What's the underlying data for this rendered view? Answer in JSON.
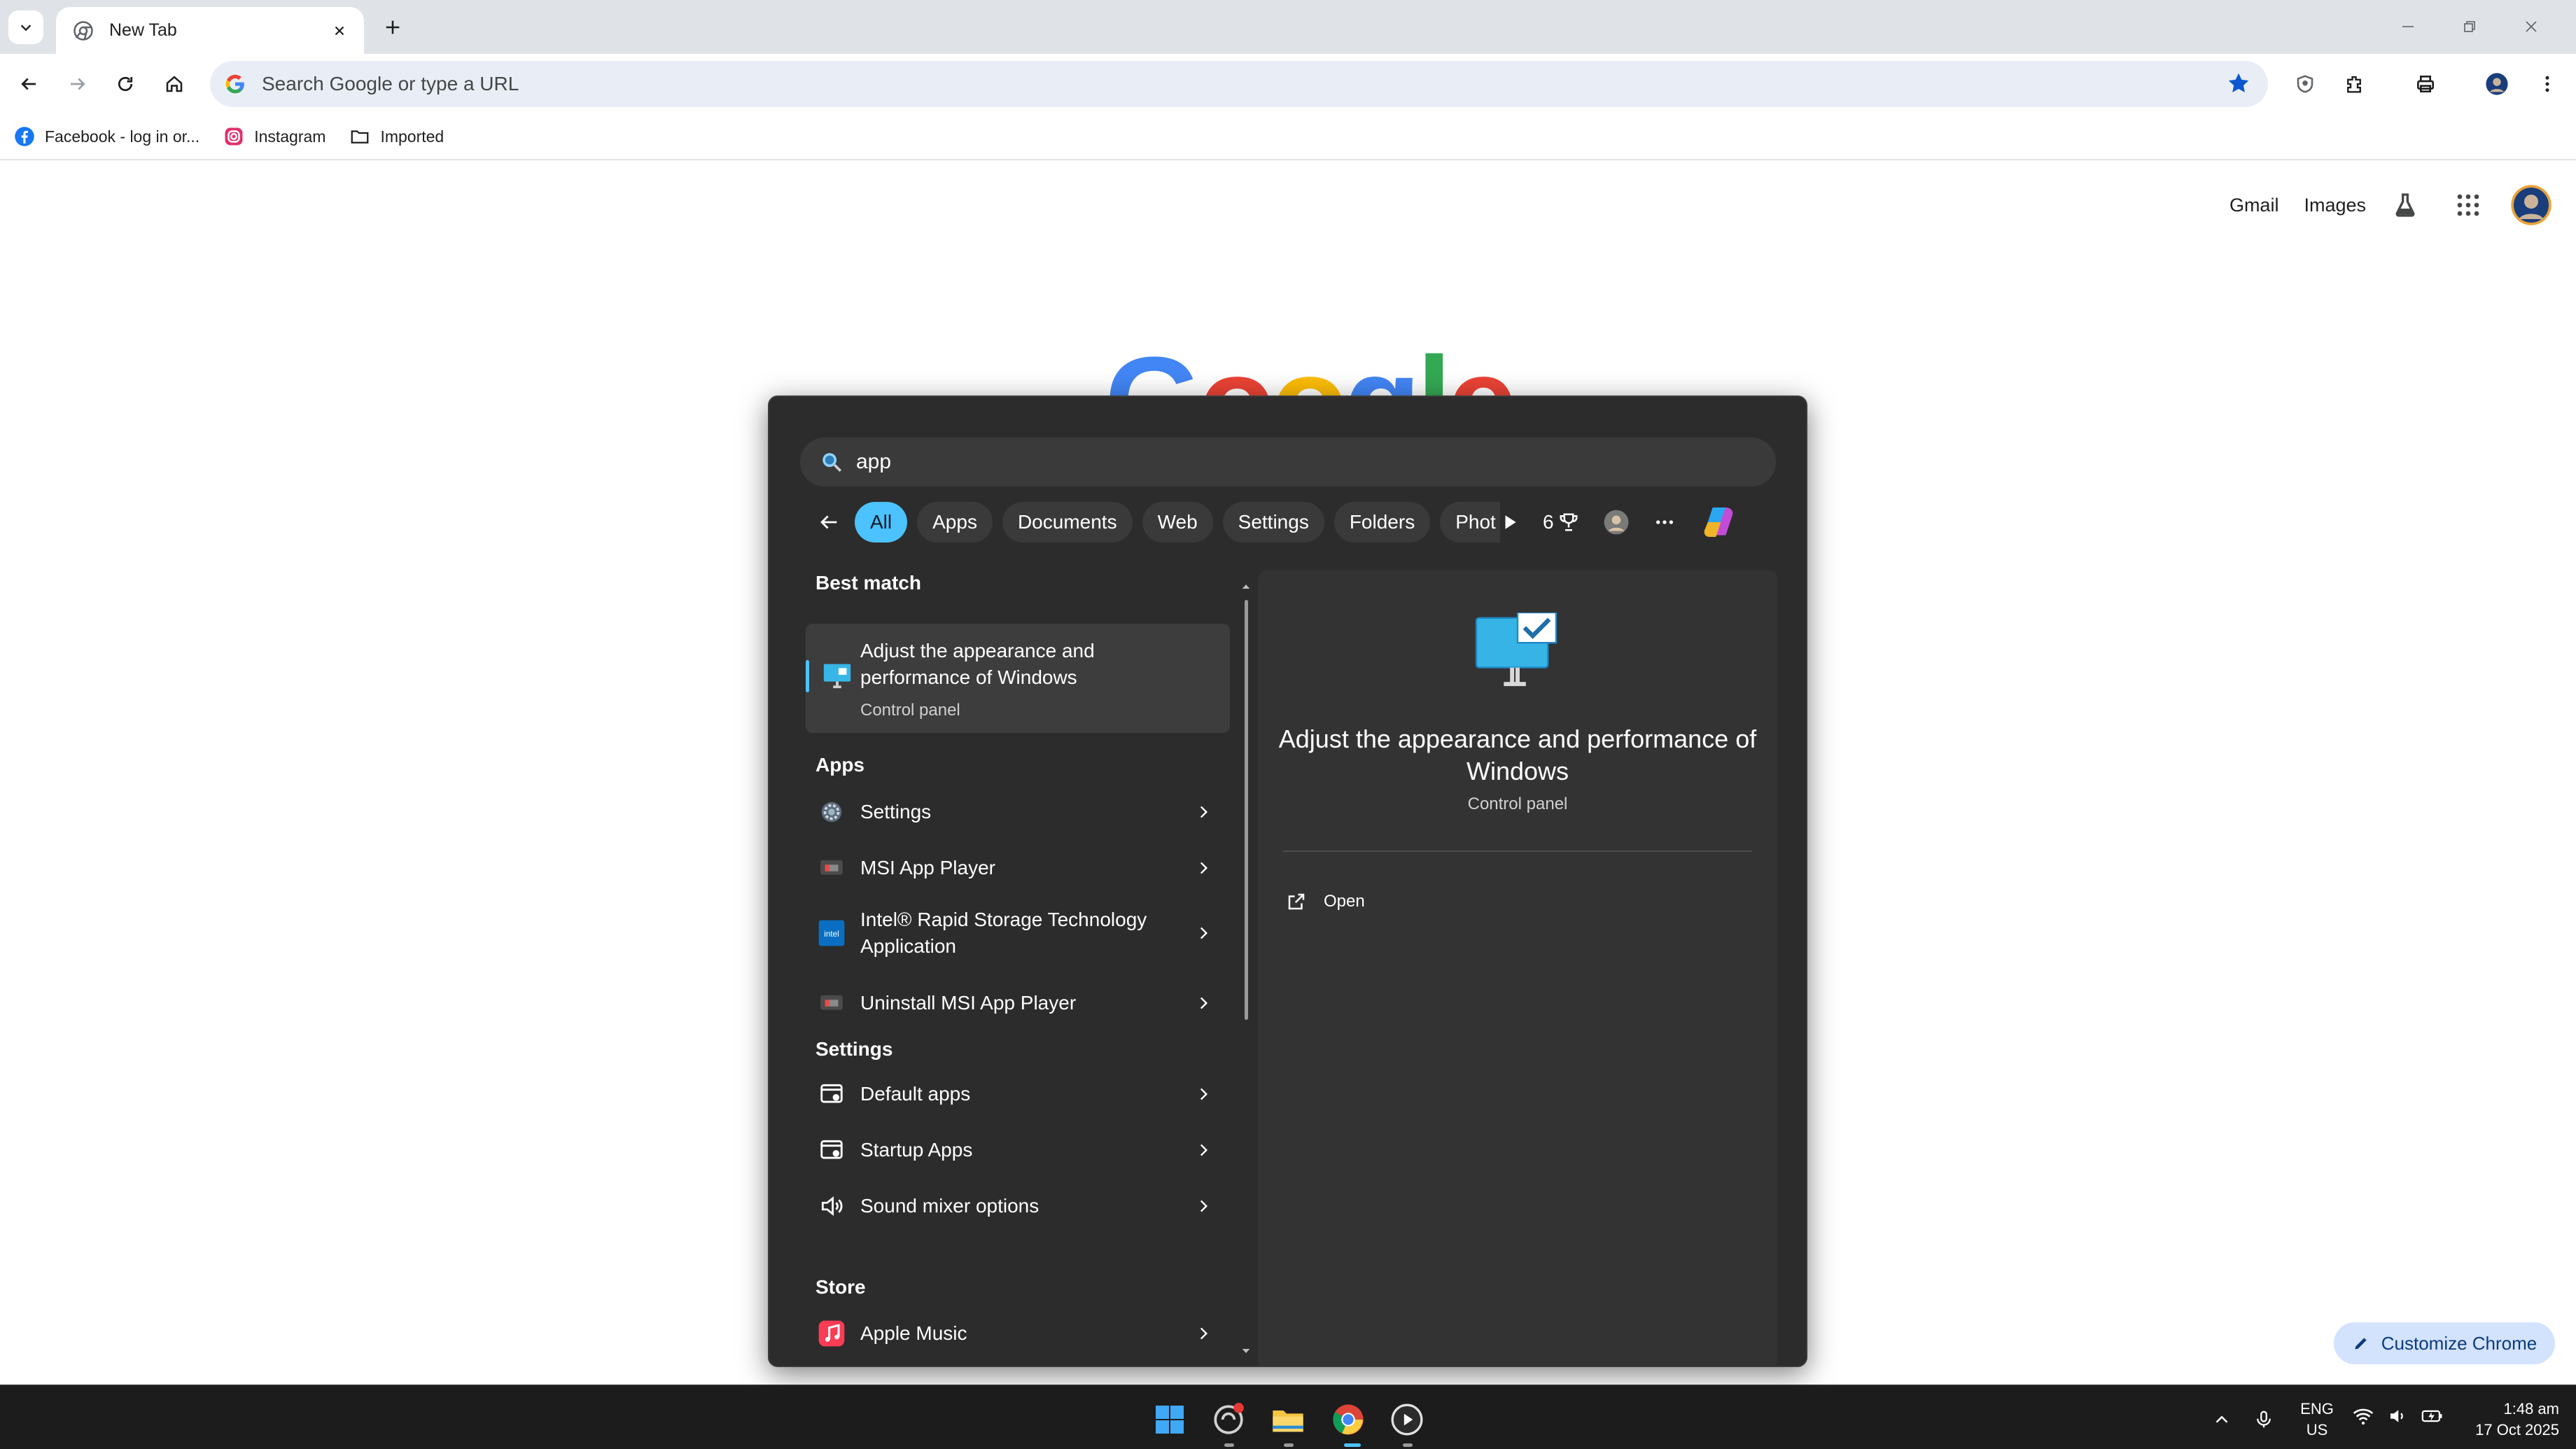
{
  "browser": {
    "tab_title": "New Tab",
    "omnibox_placeholder": "Search Google or type a URL",
    "bookmarks": [
      {
        "label": "Facebook - log in or..."
      },
      {
        "label": "Instagram"
      },
      {
        "label": "Imported"
      }
    ]
  },
  "ntp": {
    "gmail_label": "Gmail",
    "images_label": "Images",
    "customize_label": "Customize Chrome"
  },
  "search_flyout": {
    "query": "app",
    "filters": [
      "All",
      "Apps",
      "Documents",
      "Web",
      "Settings",
      "Folders",
      "Phot"
    ],
    "active_filter": "All",
    "rewards_count": "6",
    "best_match_header": "Best match",
    "best_match": {
      "title": "Adjust the appearance and performance of Windows",
      "subtitle": "Control panel"
    },
    "apps_header": "Apps",
    "apps": [
      {
        "label": "Settings"
      },
      {
        "label": "MSI App Player"
      },
      {
        "label": "Intel® Rapid Storage Technology Application"
      },
      {
        "label": "Uninstall MSI App Player"
      }
    ],
    "settings_header": "Settings",
    "settings": [
      {
        "label": "Default apps"
      },
      {
        "label": "Startup Apps"
      },
      {
        "label": "Sound mixer options"
      }
    ],
    "store_header": "Store",
    "store": [
      {
        "label": "Apple Music"
      }
    ],
    "preview": {
      "title": "Adjust the appearance and performance of Windows",
      "subtitle": "Control panel",
      "open_label": "Open"
    }
  },
  "taskbar": {
    "language": "ENG",
    "region": "US",
    "time": "1:48 am",
    "date": "17 Oct 2025"
  },
  "colors": {
    "accent": "#4cc2ff",
    "flyout_bg": "#2c2c2c",
    "chrome_blue": "#0b57d0"
  }
}
